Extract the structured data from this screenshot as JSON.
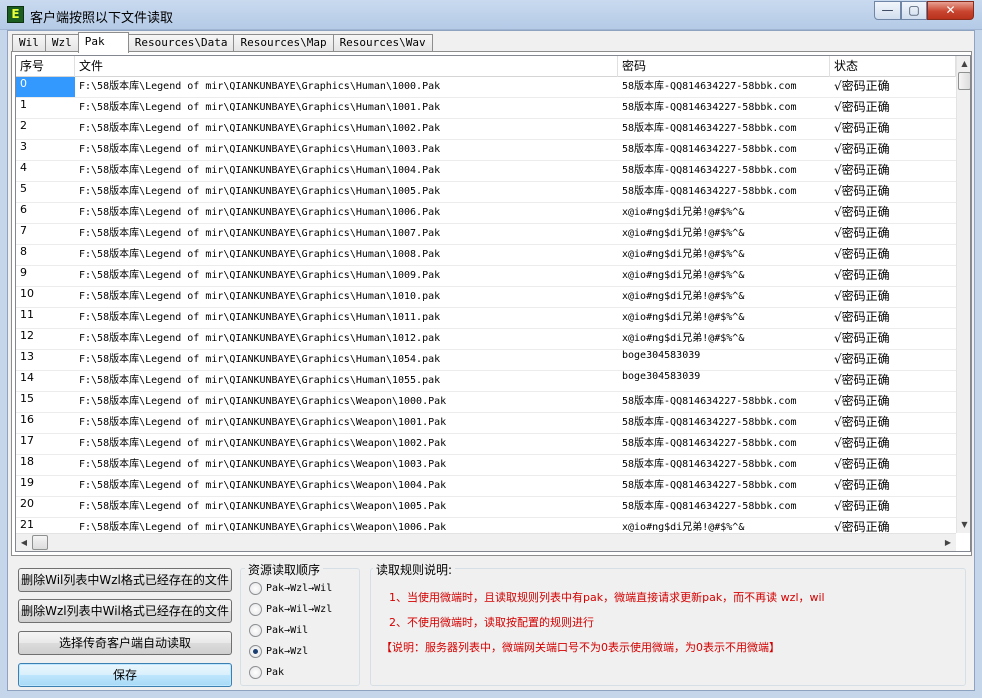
{
  "window": {
    "title": "客户端按照以下文件读取",
    "icon_letter": "E",
    "min": "—",
    "max": "▢",
    "close": "✕"
  },
  "tabs": [
    "Wil",
    "Wzl",
    "Pak",
    "Resources\\Data",
    "Resources\\Map",
    "Resources\\Wav"
  ],
  "active_tab": "Pak",
  "table": {
    "columns": [
      "序号",
      "文件",
      "密码",
      "状态"
    ],
    "selected_row": 0,
    "rows": [
      [
        "0",
        "F:\\58版本库\\Legend of mir\\QIANKUNBAYE\\Graphics\\Human\\1000.Pak",
        "58版本库-QQ814634227-58bbk.com",
        "√密码正确"
      ],
      [
        "1",
        "F:\\58版本库\\Legend of mir\\QIANKUNBAYE\\Graphics\\Human\\1001.Pak",
        "58版本库-QQ814634227-58bbk.com",
        "√密码正确"
      ],
      [
        "2",
        "F:\\58版本库\\Legend of mir\\QIANKUNBAYE\\Graphics\\Human\\1002.Pak",
        "58版本库-QQ814634227-58bbk.com",
        "√密码正确"
      ],
      [
        "3",
        "F:\\58版本库\\Legend of mir\\QIANKUNBAYE\\Graphics\\Human\\1003.Pak",
        "58版本库-QQ814634227-58bbk.com",
        "√密码正确"
      ],
      [
        "4",
        "F:\\58版本库\\Legend of mir\\QIANKUNBAYE\\Graphics\\Human\\1004.Pak",
        "58版本库-QQ814634227-58bbk.com",
        "√密码正确"
      ],
      [
        "5",
        "F:\\58版本库\\Legend of mir\\QIANKUNBAYE\\Graphics\\Human\\1005.Pak",
        "58版本库-QQ814634227-58bbk.com",
        "√密码正确"
      ],
      [
        "6",
        "F:\\58版本库\\Legend of mir\\QIANKUNBAYE\\Graphics\\Human\\1006.Pak",
        "x@io#ng$di兄弟!@#$%^&",
        "√密码正确"
      ],
      [
        "7",
        "F:\\58版本库\\Legend of mir\\QIANKUNBAYE\\Graphics\\Human\\1007.Pak",
        "x@io#ng$di兄弟!@#$%^&",
        "√密码正确"
      ],
      [
        "8",
        "F:\\58版本库\\Legend of mir\\QIANKUNBAYE\\Graphics\\Human\\1008.Pak",
        "x@io#ng$di兄弟!@#$%^&",
        "√密码正确"
      ],
      [
        "9",
        "F:\\58版本库\\Legend of mir\\QIANKUNBAYE\\Graphics\\Human\\1009.Pak",
        "x@io#ng$di兄弟!@#$%^&",
        "√密码正确"
      ],
      [
        "10",
        "F:\\58版本库\\Legend of mir\\QIANKUNBAYE\\Graphics\\Human\\1010.pak",
        "x@io#ng$di兄弟!@#$%^&",
        "√密码正确"
      ],
      [
        "11",
        "F:\\58版本库\\Legend of mir\\QIANKUNBAYE\\Graphics\\Human\\1011.pak",
        "x@io#ng$di兄弟!@#$%^&",
        "√密码正确"
      ],
      [
        "12",
        "F:\\58版本库\\Legend of mir\\QIANKUNBAYE\\Graphics\\Human\\1012.pak",
        "x@io#ng$di兄弟!@#$%^&",
        "√密码正确"
      ],
      [
        "13",
        "F:\\58版本库\\Legend of mir\\QIANKUNBAYE\\Graphics\\Human\\1054.pak",
        "boge304583039",
        "√密码正确"
      ],
      [
        "14",
        "F:\\58版本库\\Legend of mir\\QIANKUNBAYE\\Graphics\\Human\\1055.pak",
        "boge304583039",
        "√密码正确"
      ],
      [
        "15",
        "F:\\58版本库\\Legend of mir\\QIANKUNBAYE\\Graphics\\Weapon\\1000.Pak",
        "58版本库-QQ814634227-58bbk.com",
        "√密码正确"
      ],
      [
        "16",
        "F:\\58版本库\\Legend of mir\\QIANKUNBAYE\\Graphics\\Weapon\\1001.Pak",
        "58版本库-QQ814634227-58bbk.com",
        "√密码正确"
      ],
      [
        "17",
        "F:\\58版本库\\Legend of mir\\QIANKUNBAYE\\Graphics\\Weapon\\1002.Pak",
        "58版本库-QQ814634227-58bbk.com",
        "√密码正确"
      ],
      [
        "18",
        "F:\\58版本库\\Legend of mir\\QIANKUNBAYE\\Graphics\\Weapon\\1003.Pak",
        "58版本库-QQ814634227-58bbk.com",
        "√密码正确"
      ],
      [
        "19",
        "F:\\58版本库\\Legend of mir\\QIANKUNBAYE\\Graphics\\Weapon\\1004.Pak",
        "58版本库-QQ814634227-58bbk.com",
        "√密码正确"
      ],
      [
        "20",
        "F:\\58版本库\\Legend of mir\\QIANKUNBAYE\\Graphics\\Weapon\\1005.Pak",
        "58版本库-QQ814634227-58bbk.com",
        "√密码正确"
      ],
      [
        "21",
        "F:\\58版本库\\Legend of mir\\QIANKUNBAYE\\Graphics\\Weapon\\1006.Pak",
        "x@io#ng$di兄弟!@#$%^&",
        "√密码正确"
      ]
    ]
  },
  "buttons": {
    "delete_wil": "删除Wil列表中Wzl格式已经存在的文件",
    "delete_wzl": "删除Wzl列表中Wil格式已经存在的文件",
    "select_client": "选择传奇客户端自动读取",
    "save": "保存"
  },
  "read_order": {
    "title": "资源读取顺序",
    "options": [
      "Pak→Wzl→Wil",
      "Pak→Wil→Wzl",
      "Pak→Wil",
      "Pak→Wzl",
      "Pak"
    ],
    "selected": 3
  },
  "rules": {
    "title": "读取规则说明:",
    "line1": "1、当使用微端时，且读取规则列表中有pak，微端直接请求更新pak，而不再读 wzl，wil",
    "line2": "2、不使用微端时，读取按配置的规则进行",
    "note": "【说明：服务器列表中，微端网关端口号不为0表示使用微端，为0表示不用微端】"
  },
  "colors": {
    "selection": "#3399ff",
    "rule_text": "#d40000"
  }
}
